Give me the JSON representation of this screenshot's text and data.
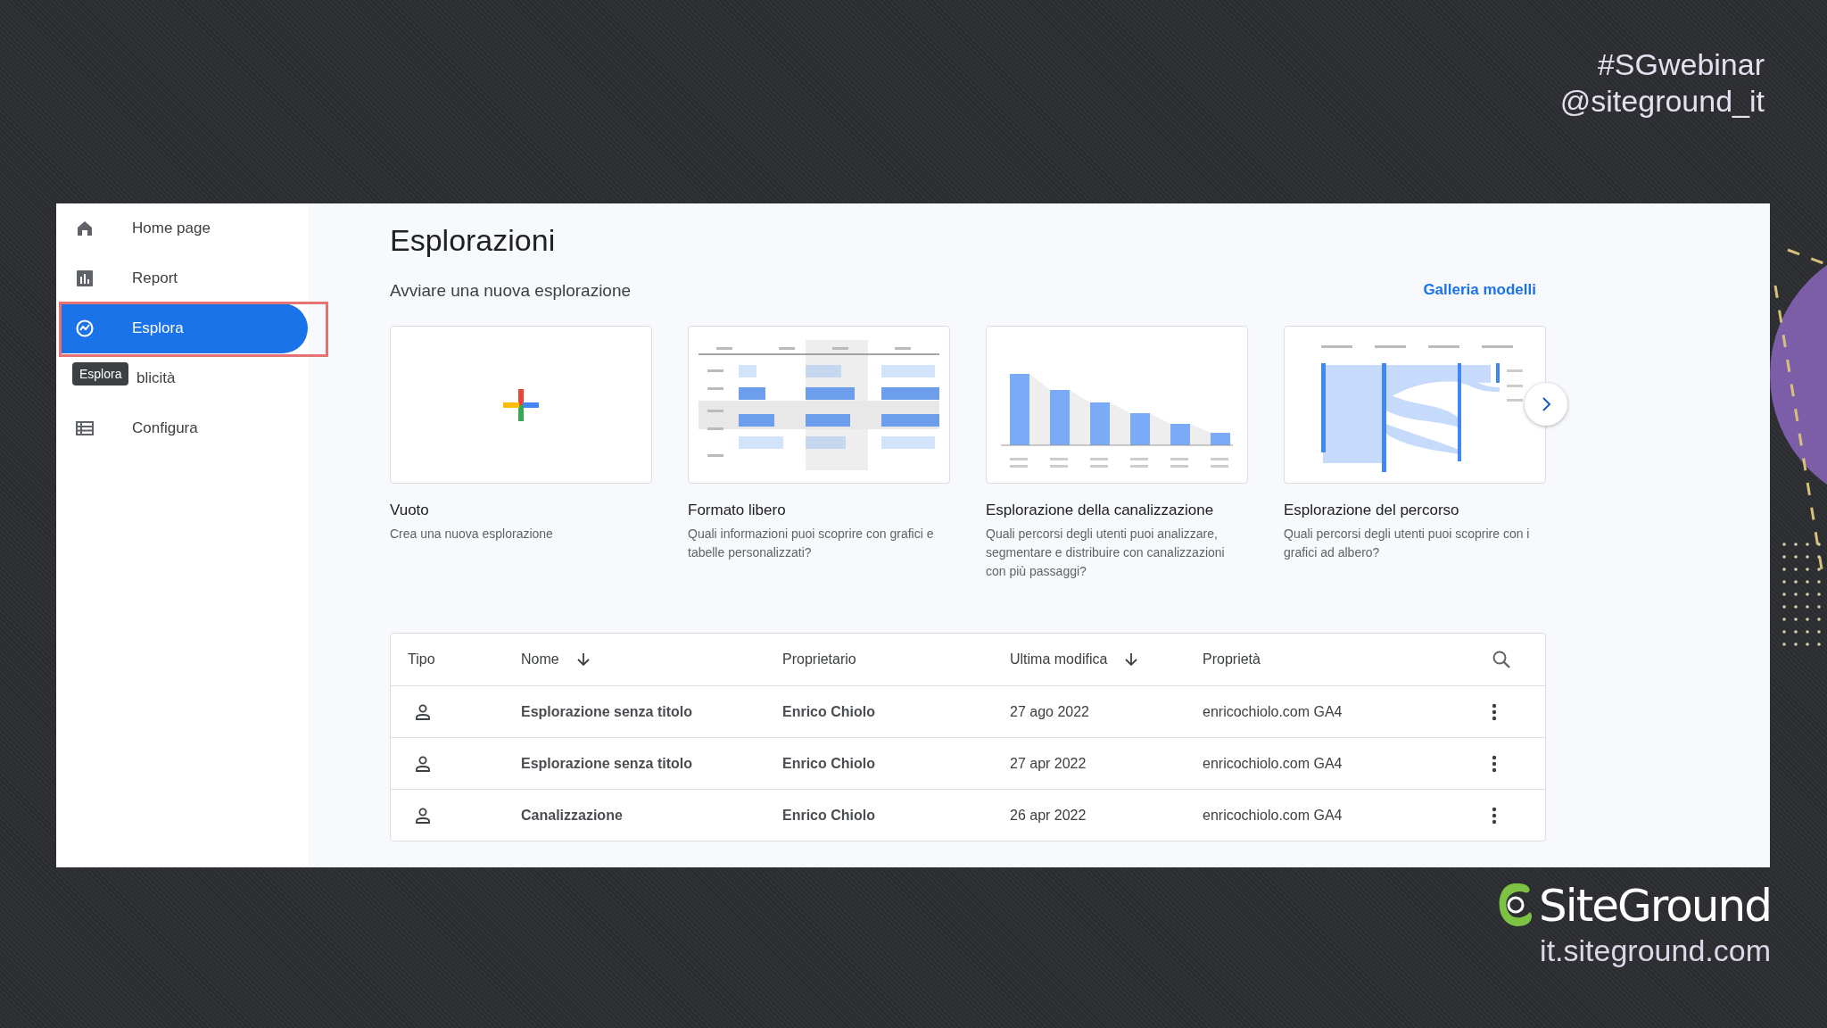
{
  "slide": {
    "hashtag": "#SGwebinar",
    "handle": "@siteground_it",
    "logo_text": "SiteGround",
    "url": "it.siteground.com"
  },
  "sidebar": {
    "tooltip": "Esplora",
    "items": [
      {
        "label": "Home page",
        "selected": false,
        "highlighted": false
      },
      {
        "label": "Report",
        "selected": false,
        "highlighted": false
      },
      {
        "label": "Esplora",
        "selected": true,
        "highlighted": true
      },
      {
        "label": "blicità",
        "selected": false,
        "highlighted": false
      },
      {
        "label": "Configura",
        "selected": false,
        "highlighted": false
      }
    ]
  },
  "page": {
    "title": "Esplorazioni",
    "subtitle": "Avviare una nuova esplorazione",
    "gallery_link": "Galleria modelli"
  },
  "templates": [
    {
      "kind": "blank",
      "title": "Vuoto",
      "description": "Crea una nuova esplorazione"
    },
    {
      "kind": "freeform",
      "title": "Formato libero",
      "description": "Quali informazioni puoi scoprire con grafici e tabelle personalizzati?"
    },
    {
      "kind": "funnel",
      "title": "Esplorazione della canalizzazione",
      "description": "Quali percorsi degli utenti puoi analizzare, segmentare e distribuire con canalizzazioni con più passaggi?"
    },
    {
      "kind": "path",
      "title": "Esplorazione del percorso",
      "description": "Quali percorsi degli utenti puoi scoprire con i grafici ad albero?"
    }
  ],
  "table": {
    "columns": [
      {
        "label": "Tipo",
        "sorted": false
      },
      {
        "label": "Nome",
        "sorted": true
      },
      {
        "label": "Proprietario",
        "sorted": false
      },
      {
        "label": "Ultima modifica",
        "sorted": true
      },
      {
        "label": "Proprietà",
        "sorted": false
      }
    ],
    "rows": [
      {
        "name": "Esplorazione senza titolo",
        "owner": "Enrico Chiolo",
        "modified": "27 ago 2022",
        "property": "enricochiolo.com GA4"
      },
      {
        "name": "Esplorazione senza titolo",
        "owner": "Enrico Chiolo",
        "modified": "27 apr 2022",
        "property": "enricochiolo.com GA4"
      },
      {
        "name": "Canalizzazione",
        "owner": "Enrico Chiolo",
        "modified": "26 apr 2022",
        "property": "enricochiolo.com GA4"
      }
    ]
  }
}
